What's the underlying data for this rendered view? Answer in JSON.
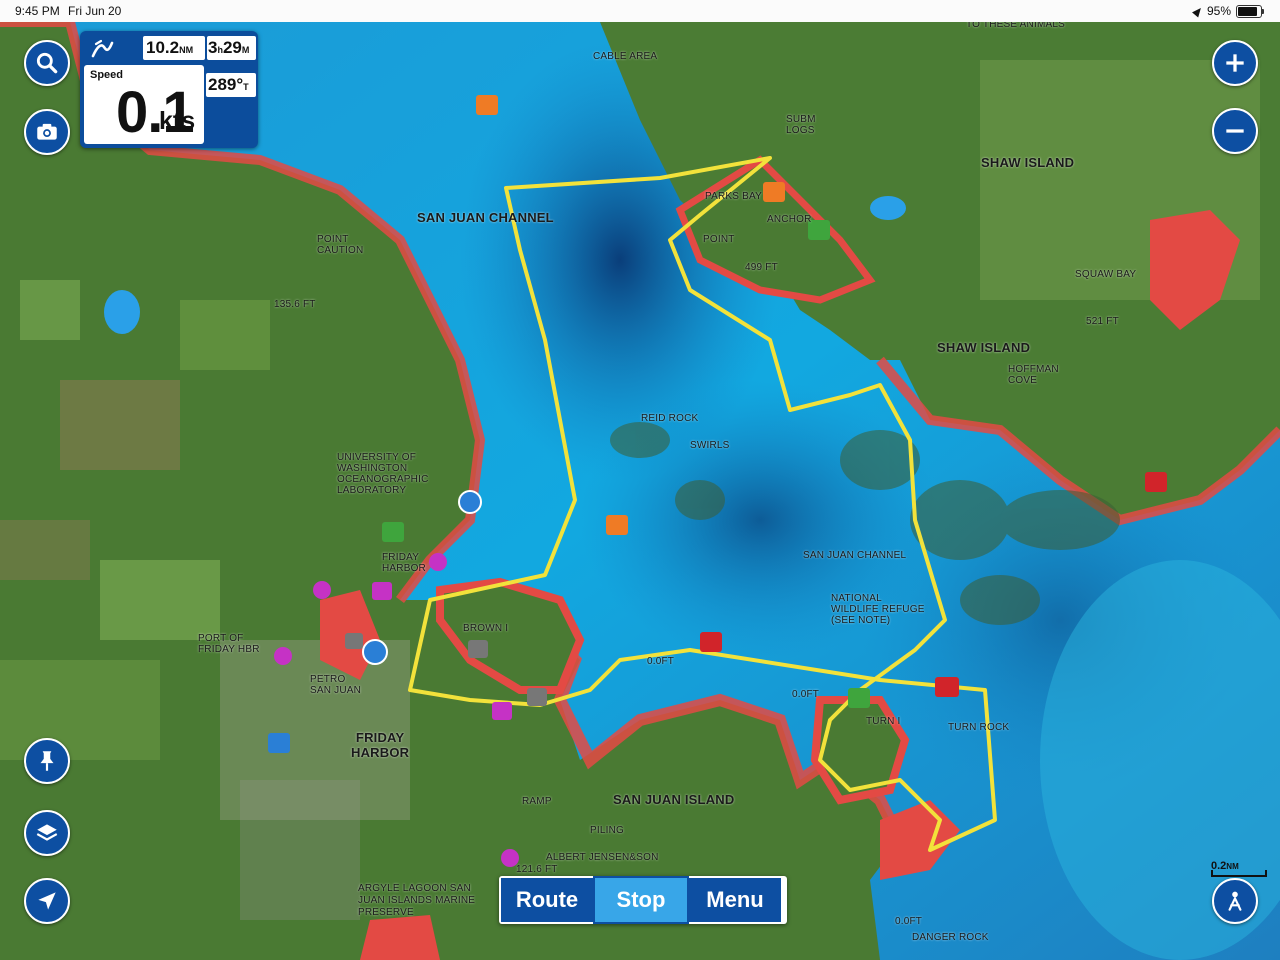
{
  "status_bar": {
    "time": "9:45 PM",
    "date": "Fri Jun 20",
    "battery": "95%",
    "battery_level": 0.95
  },
  "speed_panel": {
    "distance": "10.2",
    "distance_unit": "NM",
    "time_h": "3",
    "time_h_unit": "h",
    "time_m": "29",
    "time_m_unit": "M",
    "speed_label": "Speed",
    "speed_value": "0.1",
    "speed_unit": "kts",
    "heading": "289°",
    "heading_unit": "T"
  },
  "buttons": {
    "route": "Route",
    "stop": "Stop",
    "menu": "Menu"
  },
  "scale": {
    "value": "0.2",
    "unit": "NM"
  },
  "map_labels": {
    "san_juan_channel_n": "SAN JUAN CHANNEL",
    "san_juan_channel_s": "SAN JUAN CHANNEL",
    "shaw_island_1": "SHAW ISLAND",
    "shaw_island_2": "SHAW ISLAND",
    "san_juan_island": "SAN JUAN ISLAND",
    "friday_harbor_town": "FRIDAY\nHARBOR",
    "friday_harbor": "FRIDAY\nHARBOR",
    "port_of_friday_hbr": "PORT OF\nFRIDAY HBR",
    "petro_san_juan": "PETRO\nSAN JUAN",
    "university": "UNIVERSITY OF\nWASHINGTON\nOCEANOGRAPHIC\nLABORATORY",
    "brown_island": "BROWN I",
    "turn_island": "TURN I",
    "turn_rock": "TURN ROCK",
    "point_caution": "POINT\nCAUTION",
    "reid_rock": "REID ROCK",
    "swirls": "SWIRLS",
    "national_wildlife": "NATIONAL\nWILDLIFE REFUGE\n(SEE NOTE)",
    "squaw_bay": "SQUAW BAY",
    "hoffman_cove": "HOFFMAN\nCOVE",
    "parks_bay": "PARKS BAY",
    "anchor": "ANCHOR",
    "point": "POINT",
    "subm_logs": "SUBM\nLOGS",
    "cable_area": "CABLE AREA",
    "to_these_animals": "TO THESE ANIMALS",
    "argyle_lagoon": "ARGYLE LAGOON SAN\nJUAN ISLANDS MARINE\nPRESERVE",
    "albert_jensen": "ALBERT JENSEN&SON",
    "piling": "PILING",
    "ramp": "RAMP",
    "danger_rock": "DANGER ROCK",
    "height_1356": "135.6 FT",
    "height_1216": "121.6 FT",
    "height_499": "499 FT",
    "height_521": "521 FT",
    "zero_ft_1": "0.0FT",
    "zero_ft_2": "0.0FT",
    "zero_ft_3": "0.0FT"
  },
  "colors": {
    "accent_blue": "#0d4fa2",
    "stop_active": "#38a6e8",
    "track_yellow": "#f2e23b",
    "shallow_red": "#e34a44",
    "land_green": "#3f6a2e"
  }
}
